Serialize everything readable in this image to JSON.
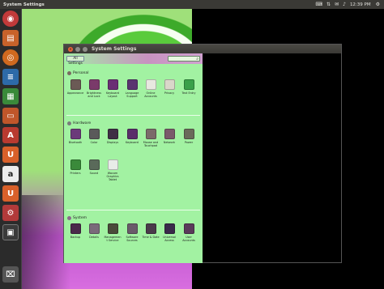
{
  "panel": {
    "title": "System Settings",
    "time": "12:39 PM"
  },
  "launcher": {
    "items": [
      "dash-home",
      "files",
      "firefox",
      "writer",
      "calc",
      "impress",
      "software-center",
      "ubuntu-one",
      "amazon",
      "ubuntu-one-music",
      "system-settings",
      "workspaces",
      "trash"
    ]
  },
  "window": {
    "title": "System Settings"
  },
  "toolbar": {
    "all_settings": "All Settings",
    "search_placeholder": ""
  },
  "sections": {
    "personal": {
      "label": "Personal",
      "items": [
        {
          "label": "Appearance",
          "icon": "appearance-icon",
          "color": "#6b5a55"
        },
        {
          "label": "Brightness and Lock",
          "icon": "brightness-icon",
          "color": "#7a3a6a"
        },
        {
          "label": "Keyboard Layout",
          "icon": "keyboard-layout-icon",
          "color": "#6a2f74"
        },
        {
          "label": "Language Support",
          "icon": "language-icon",
          "color": "#5a3470"
        },
        {
          "label": "Online Accounts",
          "icon": "online-accounts-icon",
          "color": "#e8e8e0"
        },
        {
          "label": "Privacy",
          "icon": "privacy-icon",
          "color": "#d9d6c9"
        },
        {
          "label": "Text Entry",
          "icon": "text-entry-icon",
          "color": "#3aa04a"
        }
      ]
    },
    "hardware": {
      "label": "Hardware",
      "items": [
        {
          "label": "Bluetooth",
          "icon": "bluetooth-icon",
          "color": "#6b3a7a"
        },
        {
          "label": "Color",
          "icon": "color-icon",
          "color": "#5a5a5a"
        },
        {
          "label": "Displays",
          "icon": "displays-icon",
          "color": "#3e2e45"
        },
        {
          "label": "Keyboard",
          "icon": "keyboard-icon",
          "color": "#5a2e6a"
        },
        {
          "label": "Mouse and Touchpad",
          "icon": "mouse-icon",
          "color": "#7b6a6a"
        },
        {
          "label": "Network",
          "icon": "network-icon",
          "color": "#7a5a6a"
        },
        {
          "label": "Power",
          "icon": "power-icon",
          "color": "#6a6a5a"
        },
        {
          "label": "Printers",
          "icon": "printers-icon",
          "color": "#3a8a3a"
        },
        {
          "label": "Sound",
          "icon": "sound-icon",
          "color": "#5a6a5a"
        },
        {
          "label": "Wacom Graphics Tablet",
          "icon": "wacom-icon",
          "color": "#e8ece8"
        }
      ]
    },
    "system": {
      "label": "System",
      "items": [
        {
          "label": "Backup",
          "icon": "backup-icon",
          "color": "#4a2a4a"
        },
        {
          "label": "Details",
          "icon": "details-icon",
          "color": "#7a6a7a"
        },
        {
          "label": "Management Service",
          "icon": "management-icon",
          "color": "#4a4a3a"
        },
        {
          "label": "Software Sources",
          "icon": "software-sources-icon",
          "color": "#6a5a6a"
        },
        {
          "label": "Time & Date",
          "icon": "time-date-icon",
          "color": "#4a3a4a"
        },
        {
          "label": "Universal Access",
          "icon": "universal-access-icon",
          "color": "#3a2a4a"
        },
        {
          "label": "User Accounts",
          "icon": "user-accounts-icon",
          "color": "#5a3a5a"
        }
      ]
    }
  }
}
